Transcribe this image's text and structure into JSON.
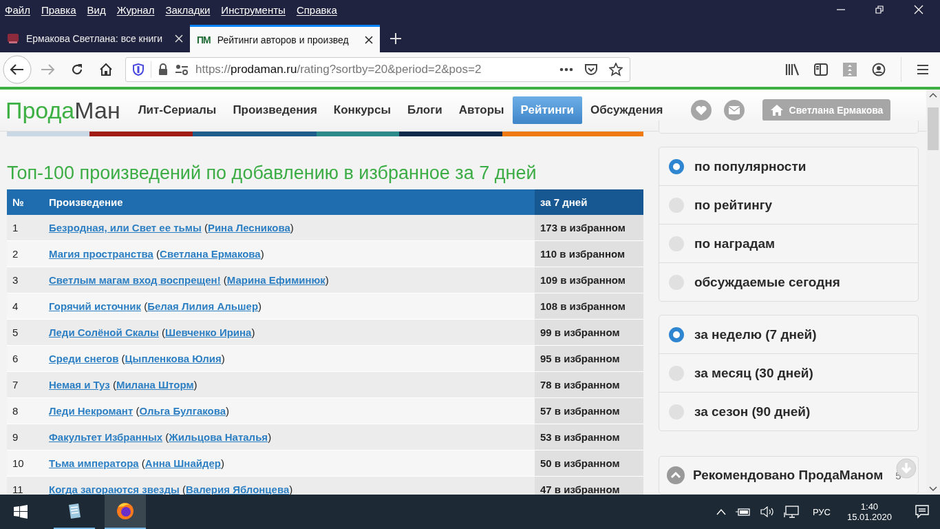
{
  "menu_bar": [
    "Файл",
    "Правка",
    "Вид",
    "Журнал",
    "Закладки",
    "Инструменты",
    "Справка"
  ],
  "tabs": [
    {
      "title": "Ермакова Светлана: все книги",
      "selected": false
    },
    {
      "title": "Рейтинги авторов и произвед",
      "selected": true,
      "favicon": "ПМ"
    }
  ],
  "address_bar": {
    "scheme": "https://",
    "host": "prodaman.ru",
    "path": "/rating?sortby=20&period=2&pos=2"
  },
  "site": {
    "logo": [
      "Прода",
      "Ман"
    ],
    "nav": [
      {
        "label": "Лит-Сериалы",
        "selected": false
      },
      {
        "label": "Произведения",
        "selected": false
      },
      {
        "label": "Конкурсы",
        "selected": false
      },
      {
        "label": "Блоги",
        "selected": false
      },
      {
        "label": "Авторы",
        "selected": false
      },
      {
        "label": "Рейтинги",
        "selected": true
      },
      {
        "label": "Обсуждения",
        "selected": false
      }
    ],
    "user": "Светлана Ермакова"
  },
  "title": "Топ-100 произведений по добавлению в избранное за 7 дней",
  "table": {
    "columns": [
      "№",
      "Произведение",
      "за 7 дней"
    ],
    "author_open": "(",
    "author_close": ")",
    "rows": [
      {
        "n": "1",
        "title": "Безродная, или Свет ее тьмы",
        "author": "Рина Лесникова",
        "count": "173 в избранном"
      },
      {
        "n": "2",
        "title": "Магия пространства",
        "author": "Светлана Ермакова",
        "count": "110 в избранном"
      },
      {
        "n": "3",
        "title": "Светлым магам вход воспрещен!",
        "author": "Марина Ефиминюк",
        "count": "109 в избранном"
      },
      {
        "n": "4",
        "title": "Горячий источник",
        "author": "Белая Лилия Альшер",
        "count": "108 в избранном"
      },
      {
        "n": "5",
        "title": "Леди Солёной Скалы",
        "author": "Шевченко Ирина",
        "count": "99 в избранном"
      },
      {
        "n": "6",
        "title": "Среди снегов",
        "author": "Цыпленкова Юлия",
        "count": "95 в избранном"
      },
      {
        "n": "7",
        "title": "Немая и Туз",
        "author": "Милана Шторм",
        "count": "78 в избранном"
      },
      {
        "n": "8",
        "title": "Леди Некромант",
        "author": "Ольга Булгакова",
        "count": "57 в избранном"
      },
      {
        "n": "9",
        "title": "Факультет Избранных",
        "author": "Жильцова Наталья",
        "count": "53 в избранном"
      },
      {
        "n": "10",
        "title": "Тьма императора",
        "author": "Анна Шнайдер",
        "count": "50 в избранном"
      },
      {
        "n": "11",
        "title": "Когда загораются звезды",
        "author": "Валерия Яблонцева",
        "count": "47 в избранном"
      }
    ]
  },
  "sort_options": [
    {
      "label": "по популярности",
      "selected": true
    },
    {
      "label": "по рейтингу",
      "selected": false
    },
    {
      "label": "по наградам",
      "selected": false
    },
    {
      "label": "обсуждаемые сегодня",
      "selected": false
    }
  ],
  "period_options": [
    {
      "label": "за неделю (7 дней)",
      "selected": true
    },
    {
      "label": "за месяц (30 дней)",
      "selected": false
    },
    {
      "label": "за сезон (90 дней)",
      "selected": false
    }
  ],
  "recommended": {
    "title": "Рекомендовано ПродаМаном",
    "badge": "5"
  },
  "taskbar": {
    "language": "РУС",
    "time": "1:40",
    "date": "15.01.2020"
  }
}
